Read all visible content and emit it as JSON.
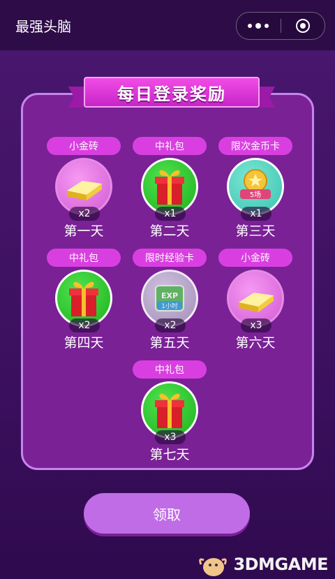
{
  "header": {
    "title": "最强头脑"
  },
  "panel": {
    "banner": "每日登录奖励"
  },
  "rewards": [
    {
      "item": "小金砖",
      "qty": "x2",
      "day": "第一天",
      "icon": "gold-bar-icon",
      "color": "#d35ad4"
    },
    {
      "item": "中礼包",
      "qty": "x1",
      "day": "第二天",
      "icon": "gift-box-icon",
      "color": "#1eb21e"
    },
    {
      "item": "限次金币卡",
      "qty": "x1",
      "day": "第三天",
      "icon": "coin-card-icon",
      "badge": "5场",
      "color": "#3bc3b1"
    },
    {
      "item": "中礼包",
      "qty": "x2",
      "day": "第四天",
      "icon": "gift-box-icon",
      "color": "#1eb21e"
    },
    {
      "item": "限时经验卡",
      "qty": "x2",
      "day": "第五天",
      "icon": "exp-card-icon",
      "badge_top": "EXP",
      "badge": "1小时",
      "color": "#a79abd"
    },
    {
      "item": "小金砖",
      "qty": "x3",
      "day": "第六天",
      "icon": "gold-bar-icon",
      "color": "#d35ad4"
    },
    {
      "item": "中礼包",
      "qty": "x3",
      "day": "第七天",
      "icon": "gift-box-icon",
      "color": "#1eb21e"
    }
  ],
  "actions": {
    "claim_label": "领取"
  },
  "watermark": {
    "text": "3DMGAME"
  }
}
